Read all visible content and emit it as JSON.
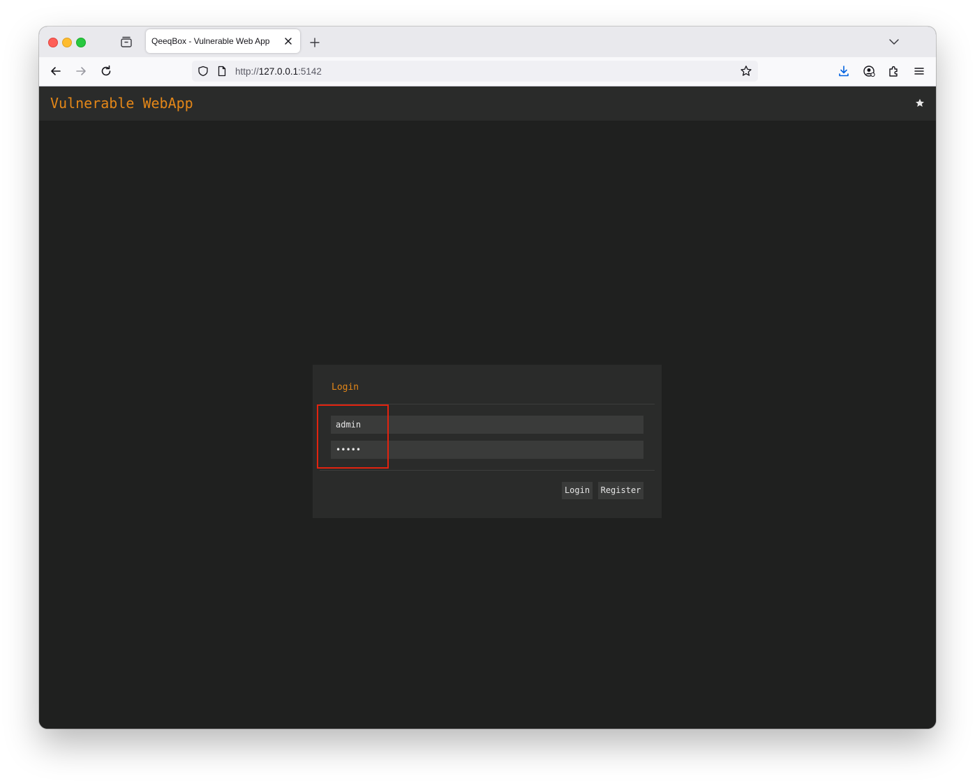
{
  "browser": {
    "tab": {
      "title": "QeeqBox - Vulnerable Web App"
    },
    "url": {
      "scheme": "http://",
      "host": "127.0.0.1",
      "port": ":5142"
    }
  },
  "app": {
    "brand": "Vulnerable WebApp",
    "login": {
      "title": "Login",
      "username_value": "admin",
      "password_value": "•••••",
      "login_label": "Login",
      "register_label": "Register"
    }
  },
  "colors": {
    "accent": "#e48718",
    "highlight_box": "#e3230f",
    "page_bg": "#1f201f",
    "panel_bg": "#2a2b2a"
  }
}
